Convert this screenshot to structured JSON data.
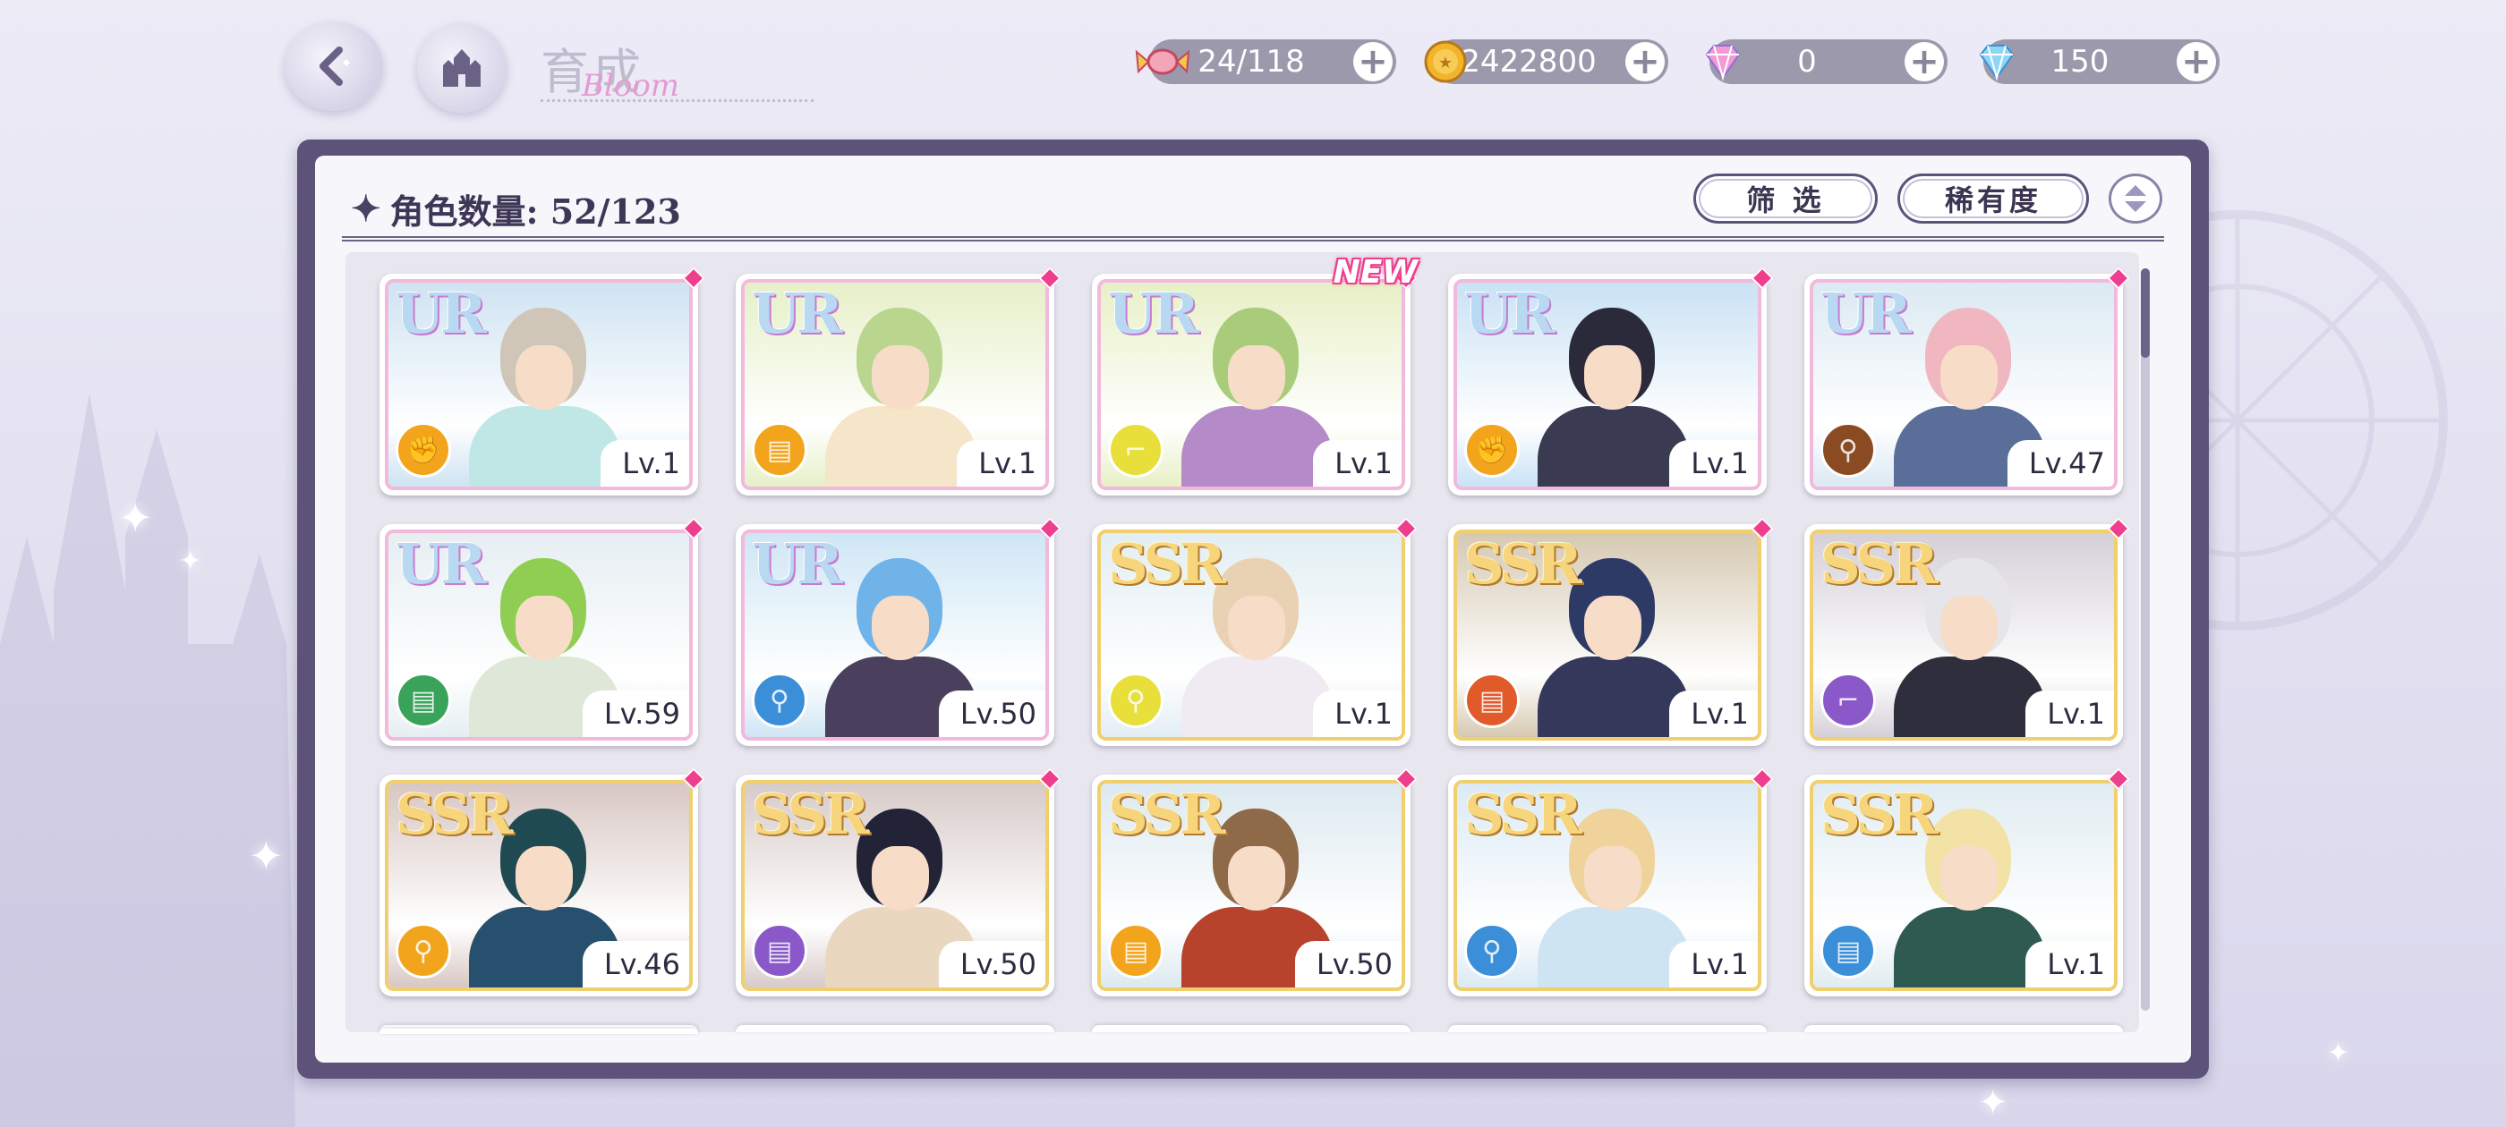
{
  "header": {
    "title": "育成",
    "title_script": "Bloom"
  },
  "resources": [
    {
      "icon": "candy-icon",
      "value": "24/118"
    },
    {
      "icon": "gold-coin-icon",
      "value": "2422800"
    },
    {
      "icon": "pink-diamond-icon",
      "value": "0"
    },
    {
      "icon": "blue-diamond-icon",
      "value": "150"
    }
  ],
  "panel": {
    "count_label": "角色数量: 52/123",
    "filter_label": "筛 选",
    "rarity_label": "稀有度"
  },
  "cards": [
    {
      "rarity": "UR",
      "level": "Lv.1",
      "attr_color": "#f2a51c",
      "attr_icon": "fist-icon",
      "hair": "#cfc6b8",
      "outfit": "#bfe7e6",
      "sky": "#cfe3f2",
      "new": false
    },
    {
      "rarity": "UR",
      "level": "Lv.1",
      "attr_color": "#f2a51c",
      "attr_icon": "book-icon",
      "hair": "#b9d58e",
      "outfit": "#f5e5c9",
      "sky": "#e6f0c8",
      "new": false
    },
    {
      "rarity": "UR",
      "level": "Lv.1",
      "attr_color": "#e8df3a",
      "attr_icon": "boot-icon",
      "hair": "#a9cc7a",
      "outfit": "#b58ac9",
      "sky": "#e8f0c6",
      "new": true,
      "new_label": "NEW"
    },
    {
      "rarity": "UR",
      "level": "Lv.1",
      "attr_color": "#f2a51c",
      "attr_icon": "fist-icon",
      "hair": "#2a2a3a",
      "outfit": "#3a3a52",
      "sky": "#c9e2f5",
      "new": false
    },
    {
      "rarity": "UR",
      "level": "Lv.47",
      "attr_color": "#8a4a22",
      "attr_icon": "spoon-icon",
      "hair": "#f0b7c0",
      "outfit": "#5a6e9a",
      "sky": "#dbe9f3",
      "new": false
    },
    {
      "rarity": "UR",
      "level": "Lv.59",
      "attr_color": "#3aa35a",
      "attr_icon": "book-icon",
      "hair": "#8fce52",
      "outfit": "#dfe8d8",
      "sky": "#e6eef2",
      "new": false
    },
    {
      "rarity": "UR",
      "level": "Lv.50",
      "attr_color": "#3b8fd8",
      "attr_icon": "magnifier-icon",
      "hair": "#6fb3e8",
      "outfit": "#4a3f5c",
      "sky": "#cfe6f5",
      "new": false
    },
    {
      "rarity": "SSR",
      "level": "Lv.1",
      "attr_color": "#e8df3a",
      "attr_icon": "magnifier-icon",
      "hair": "#e9d2b4",
      "outfit": "#f0ebf2",
      "sky": "#e2eef3",
      "new": false
    },
    {
      "rarity": "SSR",
      "level": "Lv.1",
      "attr_color": "#e05a2a",
      "attr_icon": "book-icon",
      "hair": "#2d3a66",
      "outfit": "#34395c",
      "sky": "#d6c9b2",
      "new": false
    },
    {
      "rarity": "SSR",
      "level": "Lv.1",
      "attr_color": "#8a58c9",
      "attr_icon": "boot-icon",
      "hair": "#e6e6ea",
      "outfit": "#2e2e3c",
      "sky": "#d5d0d8",
      "new": false
    },
    {
      "rarity": "SSR",
      "level": "Lv.46",
      "attr_color": "#f2a51c",
      "attr_icon": "magnifier-icon",
      "hair": "#1f4a52",
      "outfit": "#274f6e",
      "sky": "#d8c7c3",
      "new": false
    },
    {
      "rarity": "SSR",
      "level": "Lv.50",
      "attr_color": "#8a58c9",
      "attr_icon": "book-icon",
      "hair": "#232338",
      "outfit": "#e9d7c0",
      "sky": "#d7cbc9",
      "new": false
    },
    {
      "rarity": "SSR",
      "level": "Lv.50",
      "attr_color": "#f2a51c",
      "attr_icon": "book-icon",
      "hair": "#8e6a48",
      "outfit": "#b8432c",
      "sky": "#dce9f0",
      "new": false
    },
    {
      "rarity": "SSR",
      "level": "Lv.1",
      "attr_color": "#3b8fd8",
      "attr_icon": "magnifier-icon",
      "hair": "#f0d39a",
      "outfit": "#cfe4f3",
      "sky": "#dbeaf5",
      "new": false
    },
    {
      "rarity": "SSR",
      "level": "Lv.1",
      "attr_color": "#3b8fd8",
      "attr_icon": "book-icon",
      "hair": "#f3e2a6",
      "outfit": "#2e5a52",
      "sky": "#e0ecf2",
      "new": false
    }
  ]
}
